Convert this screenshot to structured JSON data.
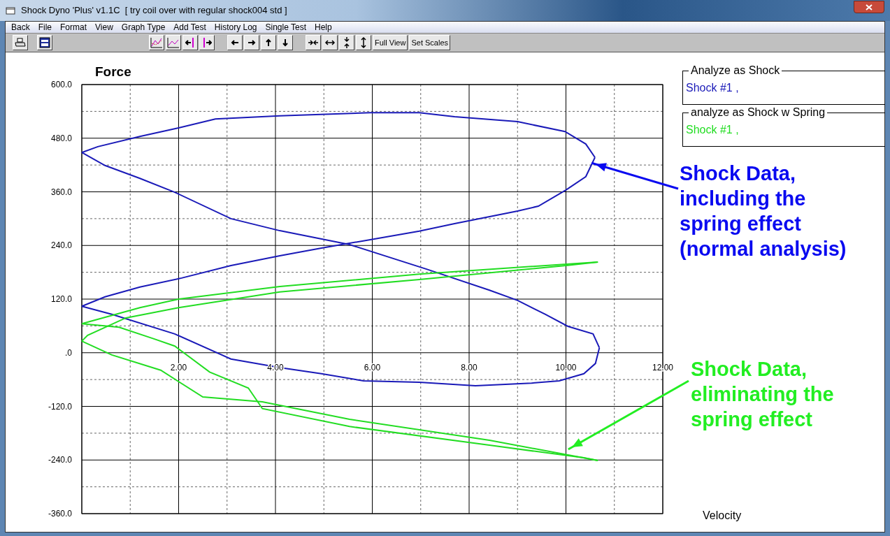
{
  "window": {
    "title": "Shock Dyno 'Plus' v1.1C  [ try coil over with regular shock004 std ]"
  },
  "menu": [
    "Back",
    "File",
    "Format",
    "View",
    "Graph Type",
    "Add Test",
    "History Log",
    "Single Test",
    "Help"
  ],
  "toolbar": [
    {
      "kind": "printer"
    },
    {
      "kind": "window"
    },
    {
      "kind": "gap"
    },
    {
      "kind": "chart-a"
    },
    {
      "kind": "chart-b"
    },
    {
      "kind": "bar-left"
    },
    {
      "kind": "bar-right"
    },
    {
      "kind": "gap"
    },
    {
      "kind": "left"
    },
    {
      "kind": "right"
    },
    {
      "kind": "up"
    },
    {
      "kind": "down"
    },
    {
      "kind": "gap"
    },
    {
      "kind": "squeeze-h"
    },
    {
      "kind": "stretch-h"
    },
    {
      "kind": "squeeze-v"
    },
    {
      "kind": "stretch-v"
    },
    {
      "kind": "text",
      "label": "Full View"
    },
    {
      "kind": "text",
      "label": "Set Scales"
    }
  ],
  "legend": [
    {
      "title": "Analyze as Shock",
      "entry": "Shock #1 ,",
      "color": "#1a1ab8"
    },
    {
      "title": "analyze as Shock w Spring",
      "entry": "Shock #1 ,",
      "color": "#22dd22"
    }
  ],
  "chart_data": {
    "type": "line",
    "title": "Force",
    "xlabel": "Velocity",
    "xlim": [
      0,
      12
    ],
    "ylim": [
      -360,
      600
    ],
    "grid": true,
    "xticks": [
      {
        "value": 2,
        "label": "2.00"
      },
      {
        "value": 4,
        "label": "4.00"
      },
      {
        "value": 6,
        "label": "6.00"
      },
      {
        "value": 8,
        "label": "8.00"
      },
      {
        "value": 10,
        "label": "10.00"
      },
      {
        "value": 12,
        "label": "12.00"
      }
    ],
    "yticks": [
      {
        "value": 600,
        "label": "600.0"
      },
      {
        "value": 480,
        "label": "480.0"
      },
      {
        "value": 360,
        "label": "360.0"
      },
      {
        "value": 240,
        "label": "240.0"
      },
      {
        "value": 120,
        "label": "120.0"
      },
      {
        "value": 0,
        "label": ".0"
      },
      {
        "value": -120,
        "label": "-120.0"
      },
      {
        "value": -240,
        "label": "-240.0"
      },
      {
        "value": -360,
        "label": "-360.0"
      }
    ],
    "series": [
      {
        "color": "#1a1ab8",
        "x": [
          0,
          0.33,
          1.2,
          2.0,
          2.76,
          4.09,
          5.96,
          6.97,
          7.7,
          9.0,
          9.98,
          10.41,
          10.6
        ],
        "values": [
          448,
          461,
          484,
          503,
          523,
          530,
          537,
          537,
          528,
          517,
          495,
          467,
          437
        ]
      },
      {
        "color": "#1a1ab8",
        "x": [
          0,
          0.48,
          1.2,
          2.06,
          3.08,
          4.09,
          4.95,
          5.96,
          6.97,
          7.7,
          9.0,
          9.43,
          10.0,
          10.41,
          10.6
        ],
        "values": [
          104,
          125,
          147,
          167,
          195,
          217,
          234,
          253,
          272,
          289,
          317,
          328,
          364,
          394,
          437
        ]
      },
      {
        "color": "#1a1ab8",
        "x": [
          0,
          0.62,
          1.92,
          3.08,
          4.09,
          4.95,
          5.82,
          6.97,
          8.13,
          9.29,
          9.86,
          10.37,
          10.61,
          10.69
        ],
        "values": [
          104,
          86,
          42,
          -14,
          -33,
          -47,
          -63,
          -66,
          -74,
          -68,
          -63,
          -47,
          -24,
          11
        ]
      },
      {
        "color": "#1a1ab8",
        "x": [
          0,
          0.48,
          1.2,
          1.92,
          3.08,
          4.09,
          5.53,
          7.12,
          8.42,
          9.0,
          9.57,
          10.04,
          10.56,
          10.69
        ],
        "values": [
          448,
          419,
          390,
          359,
          300,
          273,
          242,
          187,
          140,
          117,
          86,
          59,
          42,
          11
        ]
      },
      {
        "color": "#22dd22",
        "x": [
          0,
          1.2,
          2.0,
          4.09,
          6.97,
          10.66
        ],
        "values": [
          65,
          101,
          120,
          148,
          176,
          203
        ]
      },
      {
        "color": "#22dd22",
        "x": [
          0,
          0.12,
          0.91,
          2.0,
          4.09,
          6.97,
          10.0,
          10.66
        ],
        "values": [
          26,
          39,
          78,
          101,
          136,
          164,
          195,
          203
        ]
      },
      {
        "color": "#22dd22",
        "x": [
          0,
          0.62,
          1.63,
          2.5,
          3.73,
          5.53,
          8.42,
          10.66
        ],
        "values": [
          26,
          -5,
          -39,
          -99,
          -110,
          -149,
          -196,
          -241
        ]
      },
      {
        "color": "#22dd22",
        "x": [
          0,
          0.77,
          1.49,
          1.92,
          2.64,
          3.44,
          3.73,
          5.53,
          8.42,
          10.37,
          10.66
        ],
        "values": [
          65,
          57,
          31,
          15,
          -43,
          -79,
          -125,
          -165,
          -207,
          -235,
          -241
        ]
      }
    ]
  },
  "callouts": [
    {
      "lines": [
        "Shock Data,",
        "including the",
        "spring effect",
        "(normal analysis)"
      ],
      "color": "#0a0af0"
    },
    {
      "lines": [
        "Shock Data,",
        "eliminating the",
        "spring effect"
      ],
      "color": "#22ee22"
    }
  ]
}
